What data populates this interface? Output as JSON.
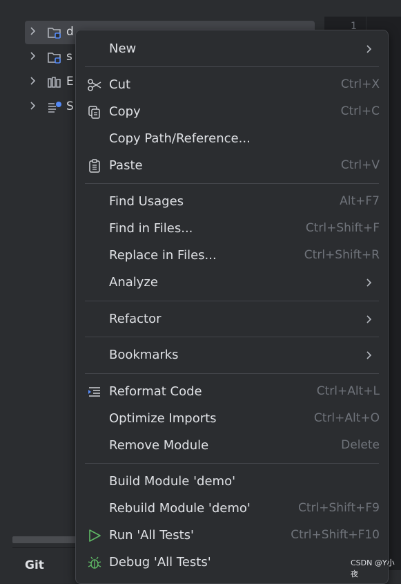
{
  "project_tree": {
    "items": [
      {
        "label": "d",
        "selected": true
      },
      {
        "label": "s",
        "selected": false
      },
      {
        "label": "E",
        "selected": false
      },
      {
        "label": "S",
        "selected": false
      }
    ]
  },
  "editor": {
    "line_number": "1"
  },
  "bottom": {
    "git_tab": "Git"
  },
  "watermark": "CSDN @Y小夜",
  "context_menu": {
    "new": "New",
    "cut": {
      "label": "Cut",
      "shortcut": "Ctrl+X"
    },
    "copy": {
      "label": "Copy",
      "shortcut": "Ctrl+C"
    },
    "copy_path": "Copy Path/Reference...",
    "paste": {
      "label": "Paste",
      "shortcut": "Ctrl+V"
    },
    "find_usages": {
      "label": "Find Usages",
      "shortcut": "Alt+F7"
    },
    "find_in_files": {
      "label": "Find in Files...",
      "shortcut": "Ctrl+Shift+F"
    },
    "replace_in_files": {
      "label": "Replace in Files...",
      "shortcut": "Ctrl+Shift+R"
    },
    "analyze": "Analyze",
    "refactor": "Refactor",
    "bookmarks": "Bookmarks",
    "reformat_code": {
      "label": "Reformat Code",
      "shortcut": "Ctrl+Alt+L"
    },
    "optimize_imports": {
      "label": "Optimize Imports",
      "shortcut": "Ctrl+Alt+O"
    },
    "remove_module": {
      "label": "Remove Module",
      "shortcut": "Delete"
    },
    "build_module": "Build Module 'demo'",
    "rebuild_module": {
      "label": "Rebuild Module 'demo'",
      "shortcut": "Ctrl+Shift+F9"
    },
    "run_tests": {
      "label": "Run 'All Tests'",
      "shortcut": "Ctrl+Shift+F10"
    },
    "debug_tests": "Debug 'All Tests'"
  },
  "colors": {
    "background": "#2b2d30",
    "editor_background": "#1e1f22",
    "menu_text": "#dfe1e5",
    "shortcut_text": "#6f737a",
    "run_icon": "#5fb865",
    "folder_badge": "#548af7"
  },
  "icons": {
    "cut": "scissors-icon",
    "copy": "copy-icon",
    "paste": "clipboard-icon",
    "reformat": "reformat-icon",
    "run": "run-triangle-icon",
    "debug": "bug-icon",
    "submenu": "chevron-right-icon"
  }
}
